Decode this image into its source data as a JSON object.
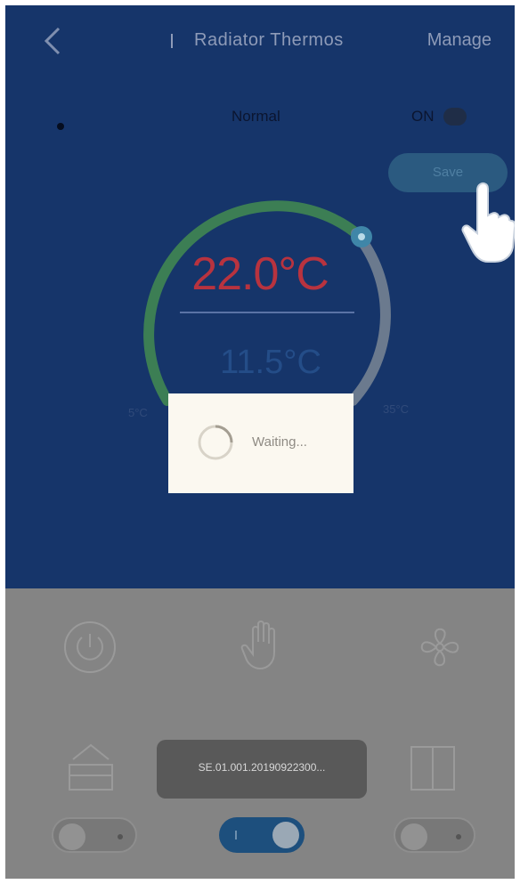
{
  "header": {
    "back_icon": "chevron-left-icon",
    "title": "Radiator Thermos",
    "manage_label": "Manage"
  },
  "mode_bar": {
    "mode_label": "Normal",
    "toggle_label": "ON"
  },
  "save_button": {
    "label": "Save"
  },
  "thermostat": {
    "set_temperature": "22.0°C",
    "current_temperature": "11.5°C",
    "range_min": "5°C",
    "range_max": "35°C"
  },
  "loading_dialog": {
    "text": "Waiting..."
  },
  "controls": {
    "icons": [
      "power-icon",
      "hand-icon",
      "fan-icon",
      "window-icon",
      "door-icon"
    ]
  },
  "toast": {
    "text": "SE.01.001.20190922300..."
  },
  "switches": {
    "left": "off",
    "middle": "on",
    "right": "off"
  },
  "colors": {
    "top_background": "#16356a",
    "bottom_background": "#848484",
    "set_temp": "#b8333f",
    "arc_green": "#3c7e54",
    "arc_gray": "#6b7a8e"
  }
}
